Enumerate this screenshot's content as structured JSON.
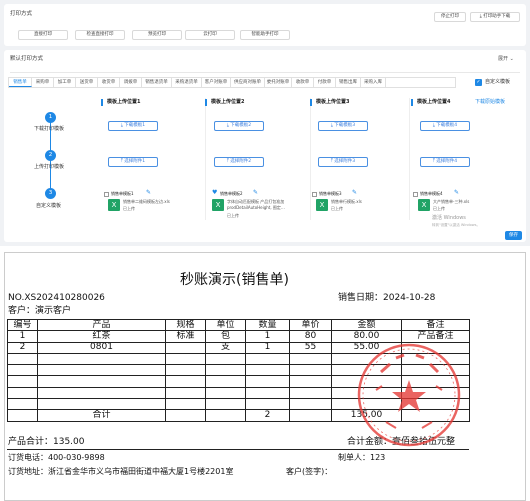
{
  "print_mode": {
    "title": "打印方式",
    "stop_print": "停止打印",
    "download_tool": "打印助手下载",
    "buttons": [
      "直接打印",
      "检查直接打印",
      "预览打印",
      "云打印",
      "智能助手打印"
    ]
  },
  "default_print": {
    "title": "默认打印方式",
    "collapse_label": "展开",
    "tabs": [
      "销售单",
      "采购单",
      "加工单",
      "送货单",
      "收货单",
      "调拨单",
      "销售退货单",
      "采购退货单",
      "客户对账单",
      "供应商对账单",
      "委托对账单",
      "收款单",
      "付款单",
      "销售出库",
      "采购入库"
    ],
    "custom_template_label": "自定义模板"
  },
  "steps": [
    {
      "num": "1",
      "label": "下载打印模板"
    },
    {
      "num": "2",
      "label": "上传打印模板"
    },
    {
      "num": "3",
      "label": "自定义模板"
    }
  ],
  "template_columns": [
    {
      "title": "模板上传位置1",
      "download": "下载模板1",
      "select": "选择附件1"
    },
    {
      "title": "模板上传位置2",
      "download": "下载模板2",
      "select": "选择附件2"
    },
    {
      "title": "模板上传位置3",
      "download": "下载模板3",
      "select": "选择附件3"
    },
    {
      "title": "模板上传位置4",
      "download": "下载模板4",
      "select": "选择附件4"
    }
  ],
  "download_original": "下载原始模板",
  "uploaded_files": [
    {
      "name": "销售单模板1",
      "file": "销售单二维码模板左边.xls",
      "status": "已上传"
    },
    {
      "name": "销售单模板2",
      "file": "字体自动匹配模板 产品打包准加prodDetailAutoHeight, 图定…",
      "status": "已上传"
    },
    {
      "name": "销售单模板3",
      "file": "销售单行模板.xls",
      "status": "已上传"
    },
    {
      "name": "销售单模板4",
      "file": "大产销售单-三种.xls",
      "status": "已上传"
    }
  ],
  "activate_windows": "激活 Windows",
  "activate_windows_sub": "转到\"设置\"以激活 Windows。",
  "save_button": "保存",
  "document": {
    "title": "秒账演示(销售单)",
    "order_no": "NO.XS202410280026",
    "sale_date": "销售日期：2024-10-28",
    "customer": "客户：演示客户",
    "headers": [
      "编号",
      "产品",
      "规格",
      "单位",
      "数量",
      "单价",
      "金额",
      "备注"
    ],
    "rows": [
      [
        "1",
        "红茶",
        "标准",
        "包",
        "1",
        "80",
        "80.00",
        "产品备注"
      ],
      [
        "2",
        "0801",
        "",
        "支",
        "1",
        "55",
        "55.00",
        ""
      ]
    ],
    "total_label": "合计",
    "total_qty": "2",
    "total_amount": "135.00",
    "product_total": "产品合计：135.00",
    "total_amount_words": "合计金额：壹佰叁拾伍元整",
    "phone": "订货电话：400-030-9898",
    "creator": "制单人：123",
    "address": "订货地址：浙江省金华市义乌市福田街道中福大厦1号楼2201室",
    "customer_sign": "客户(签字)："
  },
  "colors": {
    "accent": "#1e88e5",
    "excel": "#21a366",
    "stamp": "#e53935"
  }
}
